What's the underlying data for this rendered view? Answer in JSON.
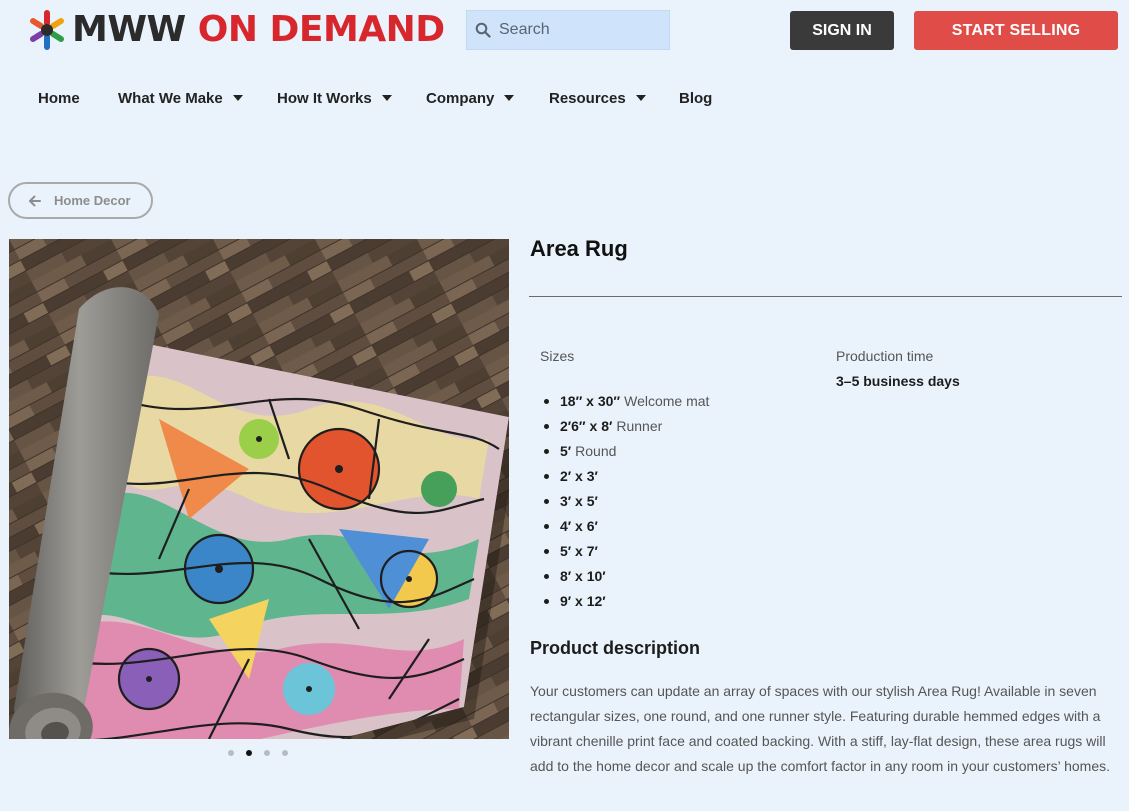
{
  "header": {
    "brand_primary": "MWW",
    "brand_secondary": "ON DEMAND",
    "search_placeholder": "Search",
    "sign_in_label": "SIGN IN",
    "start_selling_label": "START SELLING"
  },
  "nav": {
    "items": [
      {
        "label": "Home",
        "has_caret": false
      },
      {
        "label": "What We Make",
        "has_caret": true
      },
      {
        "label": "How It Works",
        "has_caret": true
      },
      {
        "label": "Company",
        "has_caret": true
      },
      {
        "label": "Resources",
        "has_caret": true
      },
      {
        "label": "Blog",
        "has_caret": false
      }
    ]
  },
  "breadcrumb": {
    "back_label": "Home Decor"
  },
  "carousel": {
    "slide_count": 4,
    "active_index": 1
  },
  "product": {
    "title": "Area Rug",
    "sizes_label": "Sizes",
    "sizes": [
      {
        "dim": "18″ x 30″",
        "note": "Welcome mat"
      },
      {
        "dim": "2′6″ x 8′",
        "note": "Runner"
      },
      {
        "dim": "5′",
        "note": "Round"
      },
      {
        "dim": "2′ x 3′",
        "note": ""
      },
      {
        "dim": "3′ x 5′",
        "note": ""
      },
      {
        "dim": "4′ x 6′",
        "note": ""
      },
      {
        "dim": "5′ x 7′",
        "note": ""
      },
      {
        "dim": "8′ x 10′",
        "note": ""
      },
      {
        "dim": "9′ x 12′",
        "note": ""
      }
    ],
    "production_label": "Production time",
    "production_value": "3–5 business days",
    "description_heading": "Product description",
    "description": "Your customers can update an array of spaces with our stylish Area Rug! Available in seven rectangular sizes, one round, and one runner style. Featuring durable hemmed edges with a vibrant chenille print face and coated backing. With a stiff, lay-flat design, these area rugs will add to the home decor and scale up the comfort factor in any room in your customers’ homes."
  },
  "colors": {
    "background": "#eaf3fc",
    "brand_dark": "#2b2b2b",
    "brand_red": "#d8272c",
    "sign_in_bg": "#3a3a3a",
    "start_selling_bg": "#e04c47",
    "search_bg": "#cfe4fb"
  }
}
